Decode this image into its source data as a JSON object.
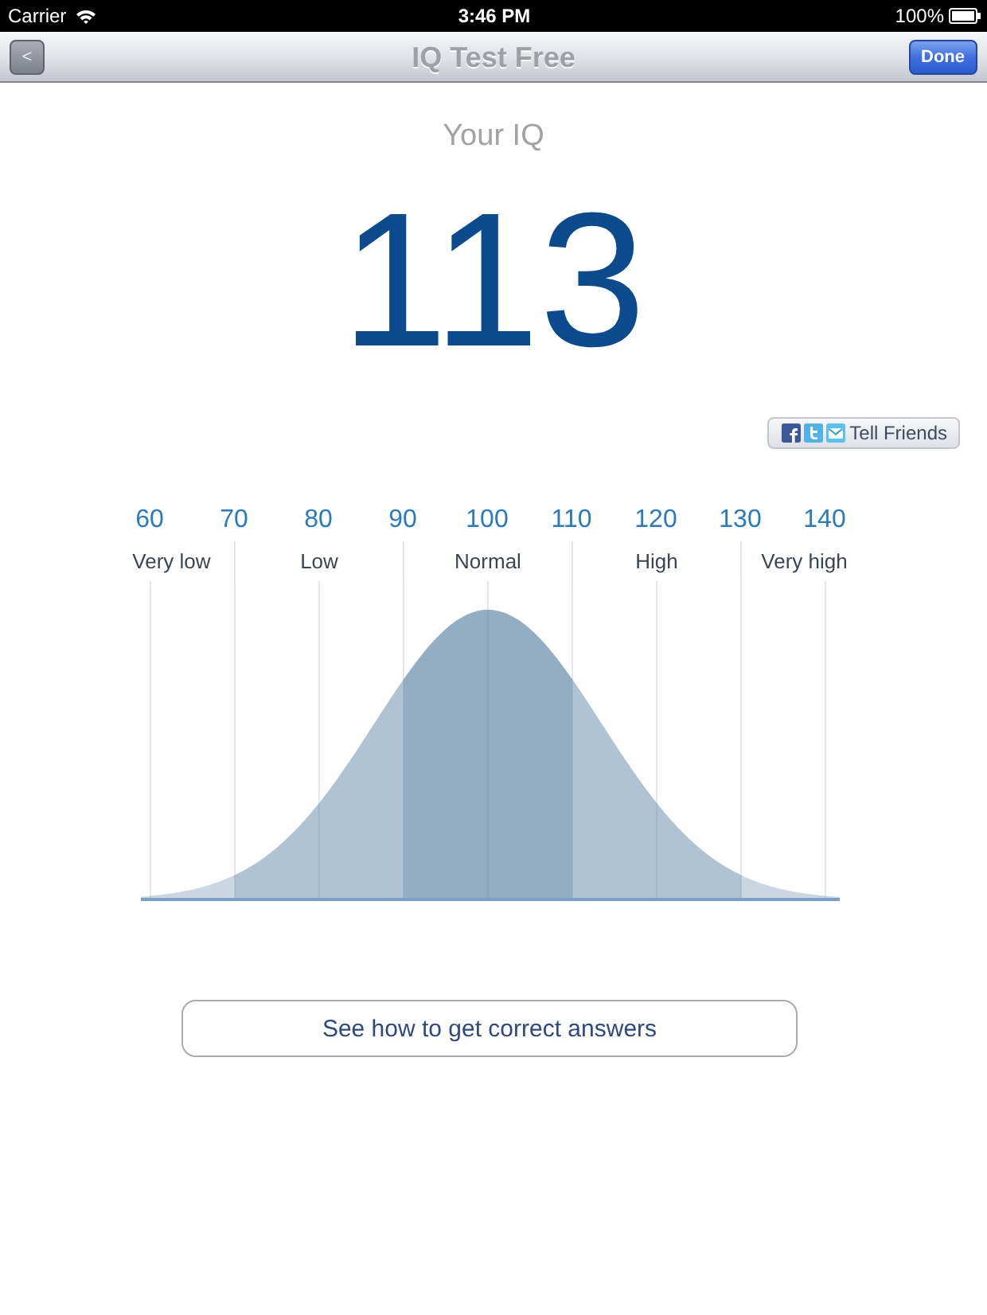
{
  "status_bar": {
    "carrier": "Carrier",
    "time": "3:46 PM",
    "battery": "100%"
  },
  "nav_bar": {
    "back_button": "<",
    "title": "IQ Test Free",
    "done_button": "Done"
  },
  "result": {
    "label": "Your IQ",
    "score": "113"
  },
  "share_button": {
    "label": "Tell Friends"
  },
  "bell_curve": {
    "ticks": [
      "60",
      "70",
      "80",
      "90",
      "100",
      "110",
      "120",
      "130",
      "140"
    ],
    "categories": [
      {
        "label": "Very low",
        "color": "#cad6e1"
      },
      {
        "label": "Low",
        "color": "#b0c3d3"
      },
      {
        "label": "Normal",
        "color": "#93adc2"
      },
      {
        "label": "High",
        "color": "#b0c3d3"
      },
      {
        "label": "Very high",
        "color": "#cad6e1"
      }
    ]
  },
  "answers_button": {
    "label": "See how to get correct answers"
  }
}
